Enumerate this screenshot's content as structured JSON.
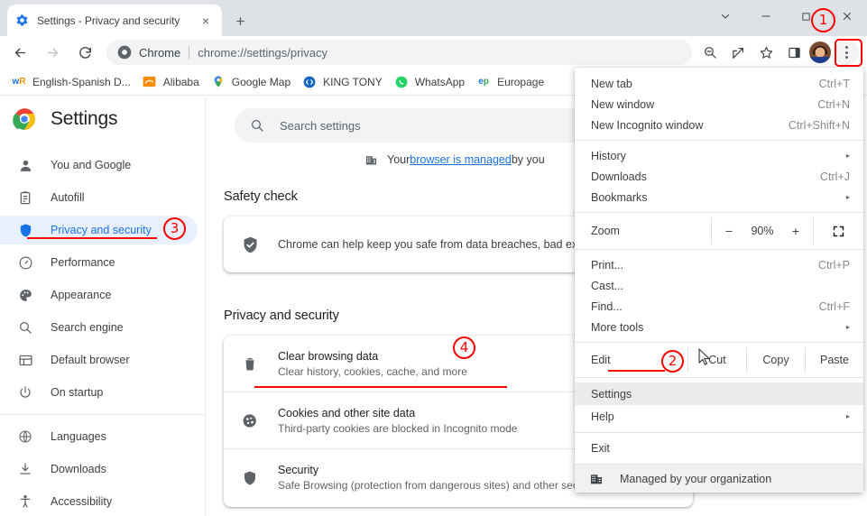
{
  "window": {
    "tab": {
      "title": "Settings - Privacy and security",
      "favicon": "gear-icon",
      "close_label": "×"
    },
    "new_tab_label": "+",
    "controls": {
      "tab_search_label": "⌄",
      "minimize_label": "—",
      "maximize_label": "☐",
      "close_label": "×"
    }
  },
  "toolbar": {
    "back_label": "←",
    "forward_label": "→",
    "reload_label": "↻",
    "omnibox": {
      "chip": "Chrome",
      "url": "chrome://settings/privacy"
    },
    "icons": [
      {
        "name": "zoom-out-icon",
        "label": "search-minus"
      },
      {
        "name": "share-icon",
        "label": "share"
      },
      {
        "name": "bookmark-star-icon",
        "label": "star"
      },
      {
        "name": "side-panel-icon",
        "label": "side-panel"
      }
    ],
    "avatar_name": "profile-avatar",
    "menu_label": "Customize and control Google Chrome"
  },
  "bookmarks": [
    {
      "label": "English-Spanish D...",
      "icon_text": "wR",
      "icon_color": "#1a73e8"
    },
    {
      "label": "Alibaba",
      "icon_text": "",
      "icon_color": "#ff6a00"
    },
    {
      "label": "Google Map",
      "icon_text": "",
      "icon_color": "#ea4335"
    },
    {
      "label": "KING TONY",
      "icon_text": "<>",
      "icon_color": "#1a73e8"
    },
    {
      "label": "WhatsApp",
      "icon_text": "",
      "icon_color": "#25d366"
    },
    {
      "label": "Europage",
      "icon_text": "ep",
      "icon_color": "#1a73e8"
    }
  ],
  "settings": {
    "brand_title": "Settings",
    "search": {
      "placeholder": "Search settings"
    },
    "managed_banner": {
      "prefix": "Your ",
      "link": "browser is managed",
      "suffix": " by you"
    },
    "sidebar": [
      {
        "label": "You and Google",
        "icon": "person-icon",
        "active": false
      },
      {
        "label": "Autofill",
        "icon": "clipboard-icon",
        "active": false
      },
      {
        "label": "Privacy and security",
        "icon": "shield-icon",
        "active": true
      },
      {
        "label": "Performance",
        "icon": "speedometer-icon",
        "active": false
      },
      {
        "label": "Appearance",
        "icon": "palette-icon",
        "active": false
      },
      {
        "label": "Search engine",
        "icon": "magnifier-icon",
        "active": false
      },
      {
        "label": "Default browser",
        "icon": "browser-window-icon",
        "active": false
      },
      {
        "label": "On startup",
        "icon": "power-icon",
        "active": false
      },
      {
        "label": "Languages",
        "icon": "globe-icon",
        "active": false
      },
      {
        "label": "Downloads",
        "icon": "download-icon",
        "active": false
      },
      {
        "label": "Accessibility",
        "icon": "accessibility-icon",
        "active": false
      }
    ],
    "safety_check": {
      "title": "Safety check",
      "text": "Chrome can help keep you safe from data breaches, bad extensions, and more"
    },
    "privacy_section": {
      "title": "Privacy and security",
      "rows": [
        {
          "title": "Clear browsing data",
          "sub": "Clear history, cookies, cache, and more",
          "icon": "trash-icon",
          "arrow": "▸"
        },
        {
          "title": "Cookies and other site data",
          "sub": "Third-party cookies are blocked in Incognito mode",
          "icon": "cookie-icon",
          "arrow": "▸"
        },
        {
          "title": "Security",
          "sub": "Safe Browsing (protection from dangerous sites) and other security settings",
          "icon": "shield-icon",
          "arrow": "▸"
        }
      ]
    }
  },
  "chrome_menu": {
    "groups": [
      {
        "items": [
          {
            "label": "New tab",
            "accel": "Ctrl+T",
            "arrow": ""
          },
          {
            "label": "New window",
            "accel": "Ctrl+N",
            "arrow": ""
          },
          {
            "label": "New Incognito window",
            "accel": "Ctrl+Shift+N",
            "arrow": ""
          }
        ]
      },
      {
        "items": [
          {
            "label": "History",
            "accel": "",
            "arrow": "▸"
          },
          {
            "label": "Downloads",
            "accel": "Ctrl+J",
            "arrow": ""
          },
          {
            "label": "Bookmarks",
            "accel": "",
            "arrow": "▸"
          }
        ]
      }
    ],
    "zoom": {
      "label": "Zoom",
      "minus": "−",
      "value": "90%",
      "plus": "+",
      "fullscreen_name": "fullscreen-icon"
    },
    "group3": [
      {
        "label": "Print...",
        "accel": "Ctrl+P",
        "arrow": ""
      },
      {
        "label": "Cast...",
        "accel": "",
        "arrow": ""
      },
      {
        "label": "Find...",
        "accel": "Ctrl+F",
        "arrow": ""
      },
      {
        "label": "More tools",
        "accel": "",
        "arrow": "▸"
      }
    ],
    "edit_row": {
      "label": "Edit",
      "cut": "Cut",
      "copy": "Copy",
      "paste": "Paste"
    },
    "group4": [
      {
        "label": "Settings",
        "accel": "",
        "arrow": "",
        "highlight": true
      },
      {
        "label": "Help",
        "accel": "",
        "arrow": "▸",
        "highlight": false
      }
    ],
    "group5": [
      {
        "label": "Exit",
        "accel": "",
        "arrow": "",
        "highlight": false
      }
    ],
    "footer": {
      "label": "Managed by your organization",
      "icon": "building-icon"
    }
  },
  "annotations": {
    "accent_color": "#ff0000",
    "markers": [
      {
        "id": "1",
        "target": "three-dot-menu-button"
      },
      {
        "id": "2",
        "target": "menu-item-settings"
      },
      {
        "id": "3",
        "target": "sidebar-item-privacy-and-security"
      },
      {
        "id": "4",
        "target": "clear-browsing-data-row"
      }
    ]
  }
}
